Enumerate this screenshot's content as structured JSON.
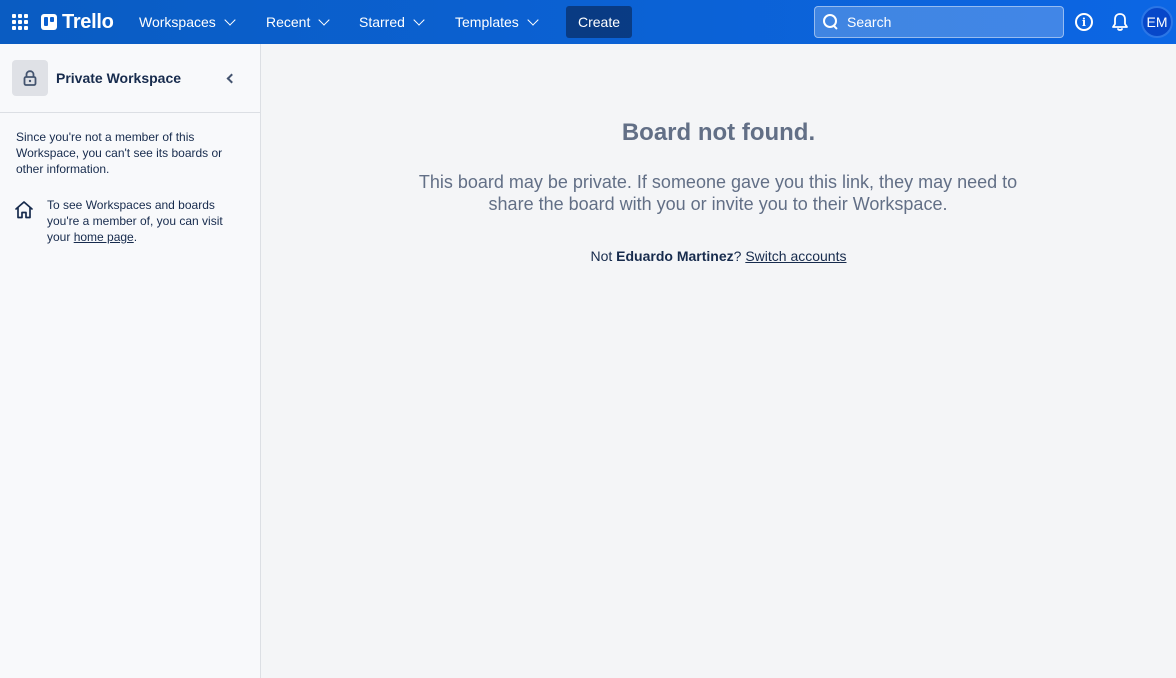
{
  "header": {
    "logo_text": "Trello",
    "nav": [
      {
        "label": "Workspaces"
      },
      {
        "label": "Recent"
      },
      {
        "label": "Starred"
      },
      {
        "label": "Templates"
      }
    ],
    "create_label": "Create",
    "search": {
      "placeholder": "Search",
      "value": ""
    },
    "avatar_initials": "EM",
    "brand_color": "#0c66e4"
  },
  "sidebar": {
    "workspace_name": "Private Workspace",
    "not_member_text": "Since you're not a member of this Workspace, you can't see its boards or other information.",
    "home_text_before": "To see Workspaces and boards you're a member of, you can visit your ",
    "home_link": "home page",
    "home_text_after": "."
  },
  "main": {
    "title": "Board not found.",
    "description": "This board may be private. If someone gave you this link, they may need to share the board with you or invite you to their Workspace.",
    "not_prefix": "Not ",
    "user_name": "Eduardo Martinez",
    "not_suffix": "? ",
    "switch_link": "Switch accounts"
  }
}
